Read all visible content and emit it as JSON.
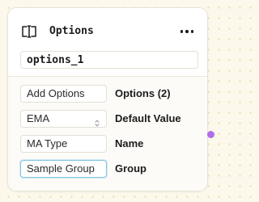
{
  "node": {
    "title": "Options",
    "name_value": "options_1",
    "menu_icon": "more-horizontal-icon",
    "type_icon": "text-cursor-icon"
  },
  "rows": [
    {
      "field_value": "Add Options",
      "label": "Options (2)",
      "kind": "button"
    },
    {
      "field_value": "EMA",
      "label": "Default Value",
      "kind": "select"
    },
    {
      "field_value": "MA Type",
      "label": "Name",
      "kind": "input"
    },
    {
      "field_value": "Sample Group",
      "label": "Group",
      "kind": "input"
    }
  ],
  "colors": {
    "canvas": "#fdf8ec",
    "canvas_dots": "#efd9a6",
    "output_handle": "#b06ee8",
    "focus_border": "#84c6df"
  }
}
